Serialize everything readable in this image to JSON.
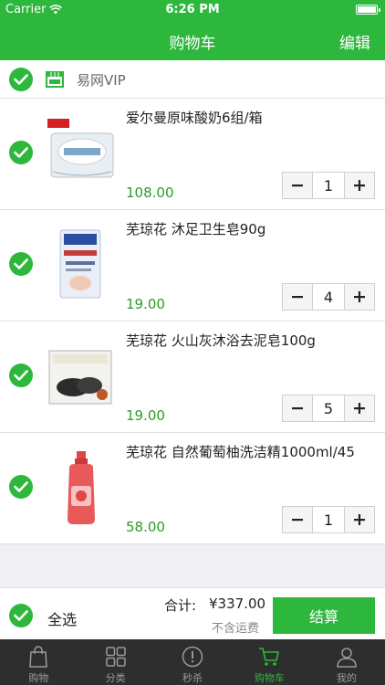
{
  "status_bar": {
    "carrier": "Carrier",
    "time": "6:26 PM"
  },
  "nav": {
    "title": "购物车",
    "edit_label": "编辑"
  },
  "store": {
    "name": "易网VIP",
    "checked": true
  },
  "items": [
    {
      "name": "爱尔曼原味酸奶6组/箱",
      "price": "108.00",
      "quantity": "1",
      "checked": true,
      "thumb_icon": "yogurt-box-image"
    },
    {
      "name": "芜琼花 沐足卫生皂90g",
      "price": "19.00",
      "quantity": "4",
      "checked": true,
      "thumb_icon": "foot-soap-image"
    },
    {
      "name": "芜琼花 火山灰沐浴去泥皂100g",
      "price": "19.00",
      "quantity": "5",
      "checked": true,
      "thumb_icon": "volcanic-soap-image"
    },
    {
      "name": "芜琼花 自然葡萄柚洗洁精1000ml/45",
      "price": "58.00",
      "quantity": "1",
      "checked": true,
      "thumb_icon": "dish-soap-bottle-image"
    }
  ],
  "footer": {
    "select_all_label": "全选",
    "total_label": "合计:",
    "total_value": "¥337.00",
    "shipping_note": "不含运费",
    "checkout_label": "结算"
  },
  "tabs": [
    {
      "label": "购物",
      "icon": "shopping-bag-icon",
      "active": false
    },
    {
      "label": "分类",
      "icon": "grid-icon",
      "active": false
    },
    {
      "label": "秒杀",
      "icon": "flash-sale-icon",
      "active": false
    },
    {
      "label": "购物车",
      "icon": "cart-icon",
      "active": true
    },
    {
      "label": "我的",
      "icon": "user-icon",
      "active": false
    }
  ],
  "colors": {
    "brand_green": "#2db83d",
    "price_green": "#2a9d2a",
    "tabbar_bg": "#2e2e2e"
  }
}
